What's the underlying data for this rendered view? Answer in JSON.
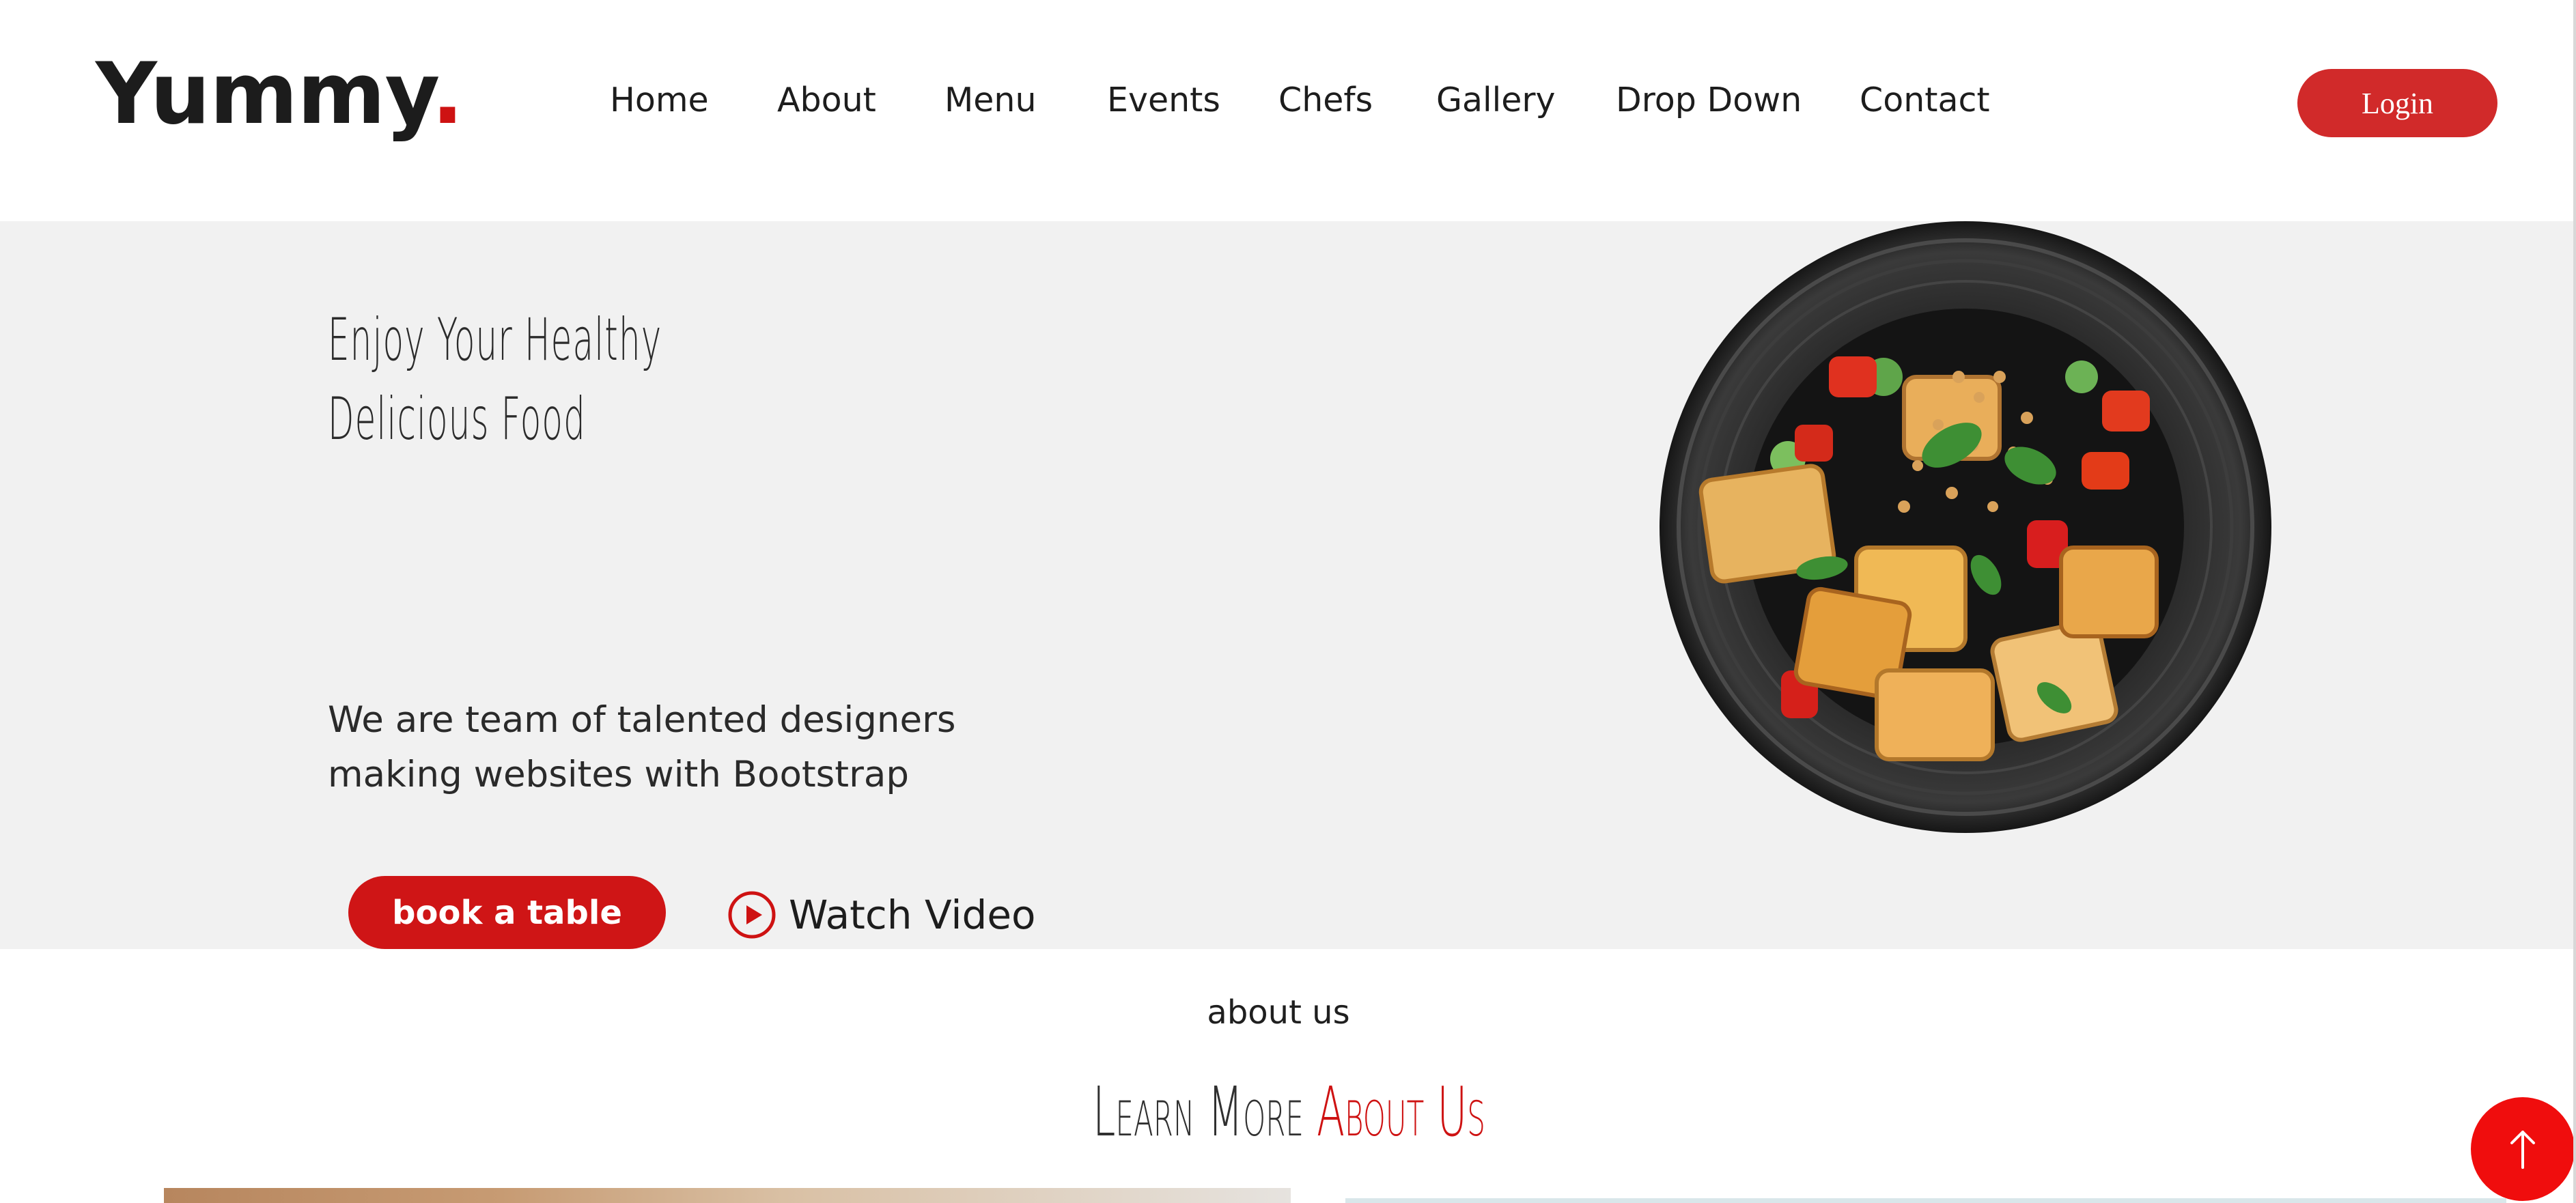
{
  "brand": {
    "name": "Yummy",
    "dot": "."
  },
  "nav": {
    "items": [
      {
        "label": "Home"
      },
      {
        "label": "About"
      },
      {
        "label": "Menu"
      },
      {
        "label": "Events"
      },
      {
        "label": "Chefs"
      },
      {
        "label": "Gallery"
      },
      {
        "label": "Drop Down"
      },
      {
        "label": "Contact"
      }
    ],
    "login_label": "Login"
  },
  "hero": {
    "title_line1": "Enjoy Your Healthy",
    "title_line2": "Delicious Food",
    "subtitle": "We are team of talented designers making websites with Bootstrap",
    "book_label": "book a table",
    "watch_label": "Watch Video"
  },
  "about": {
    "small_title": "about us",
    "heading_plain": "Learn More ",
    "heading_accent": "About Us"
  },
  "icons": {
    "play": "play-circle-icon",
    "scroll_top": "arrow-up-icon",
    "dish_image": "food-plate-image"
  },
  "colors": {
    "accent": "#ce1212",
    "login_bg": "#d12a2a",
    "hero_bg": "#f1f1f1",
    "scroll_top_bg": "#f00d0d"
  }
}
